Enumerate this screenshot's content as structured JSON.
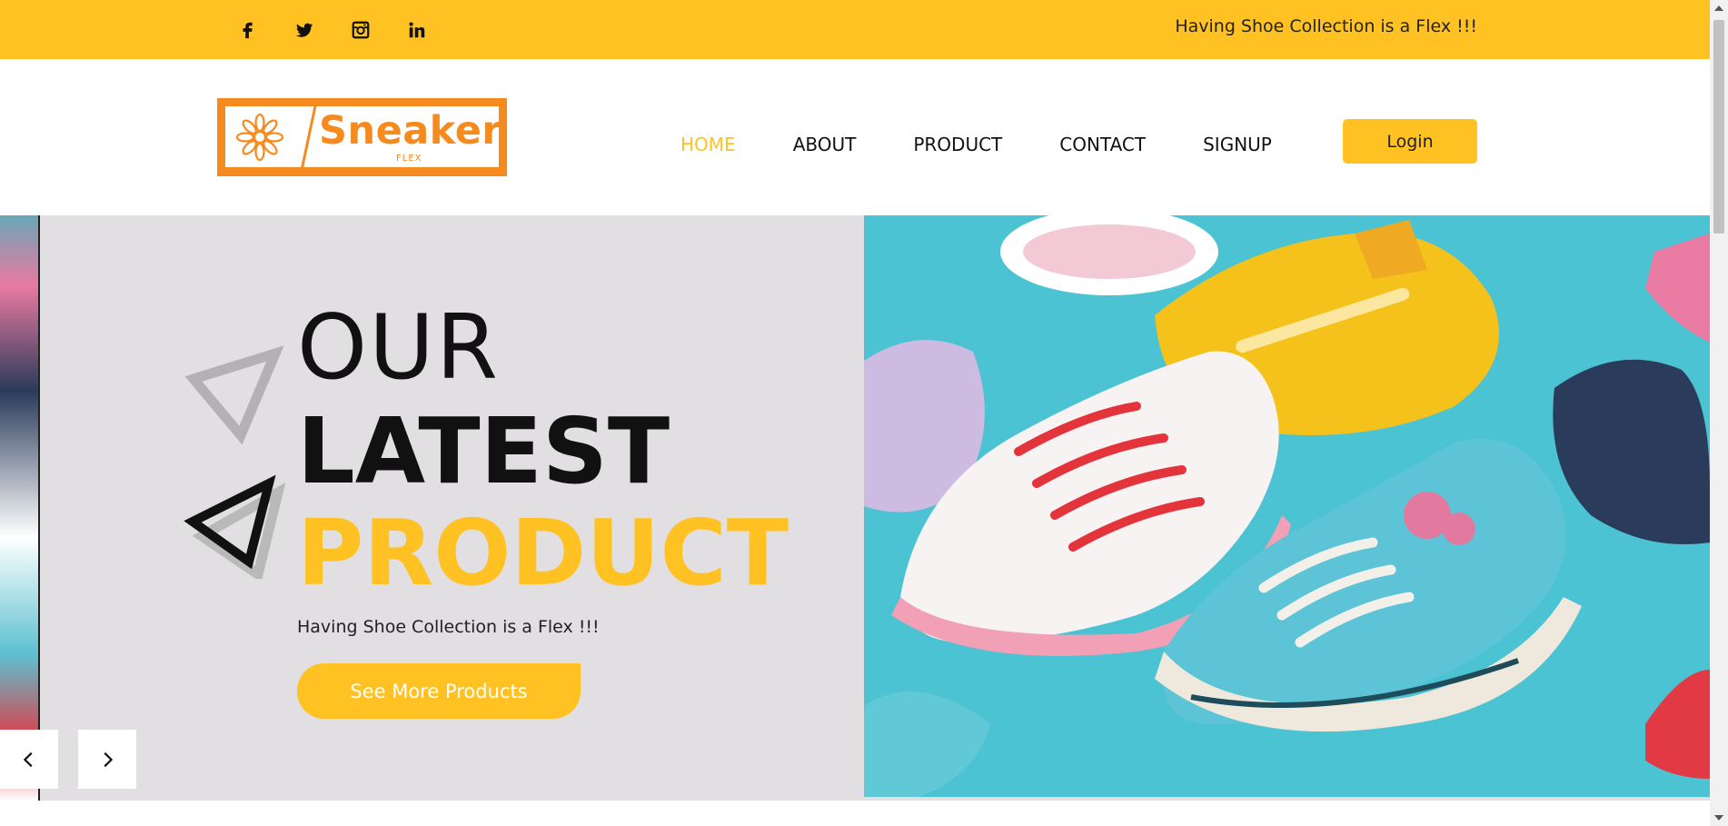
{
  "topbar": {
    "social": [
      {
        "name": "facebook-icon"
      },
      {
        "name": "twitter-icon"
      },
      {
        "name": "instagram-icon"
      },
      {
        "name": "linkedin-icon"
      }
    ],
    "tagline": "Having Shoe Collection is a Flex !!!"
  },
  "logo": {
    "brand": "Sneakers",
    "sub": "FLEX"
  },
  "nav": {
    "items": [
      "HOME",
      "ABOUT",
      "PRODUCT",
      "CONTACT",
      "SIGNUP"
    ],
    "active": "HOME",
    "login_label": "Login"
  },
  "hero": {
    "line1": "OUR",
    "line2": "LATEST",
    "line3": "PRODUCT",
    "subtitle": "Having Shoe Collection is a Flex !!!",
    "cta_label": "See More Products"
  },
  "colors": {
    "accent": "#ffc222",
    "logo_orange": "#f58a1f",
    "hero_bg": "#e1dfe1",
    "teal": "#4cc3d2"
  },
  "icons": {
    "prev": "chevron-left-icon",
    "next": "chevron-right-icon"
  }
}
